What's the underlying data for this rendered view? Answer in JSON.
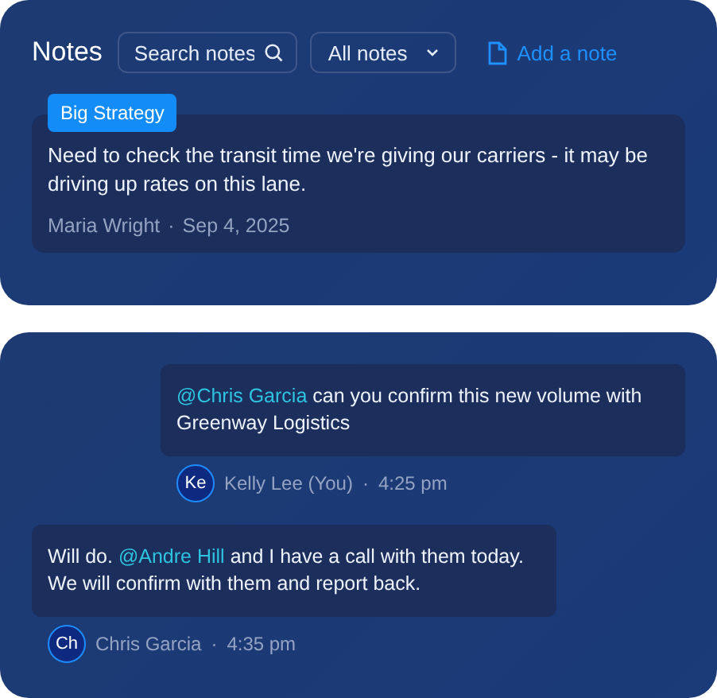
{
  "header": {
    "title": "Notes",
    "search": {
      "placeholder": "Search notes"
    },
    "filter": {
      "value": "All notes"
    },
    "add_button": "Add a note"
  },
  "note": {
    "tag": "Big Strategy",
    "text": "Need to check the transit time we're giving our carriers - it may be driving up rates on this lane.",
    "author": "Maria Wright",
    "separator": "·",
    "date": "Sep 4, 2025"
  },
  "messages": [
    {
      "kind": "sent",
      "parts": [
        {
          "kind": "mention",
          "text": "@Chris Garcia"
        },
        {
          "kind": "text",
          "text": " can you confirm this new volume with Greenway Logistics"
        }
      ],
      "initials": "Ke",
      "author": "Kelly Lee (You)",
      "separator": "·",
      "time": "4:25 pm"
    },
    {
      "kind": "received",
      "parts": [
        {
          "kind": "text",
          "text": "Will do. "
        },
        {
          "kind": "mention",
          "text": "@Andre Hill"
        },
        {
          "kind": "text",
          "text": " and I have a call with them today. We will confirm with them and report back."
        }
      ],
      "initials": "Ch",
      "author": "Chris Garcia",
      "separator": "·",
      "time": "4:35 pm"
    }
  ]
}
